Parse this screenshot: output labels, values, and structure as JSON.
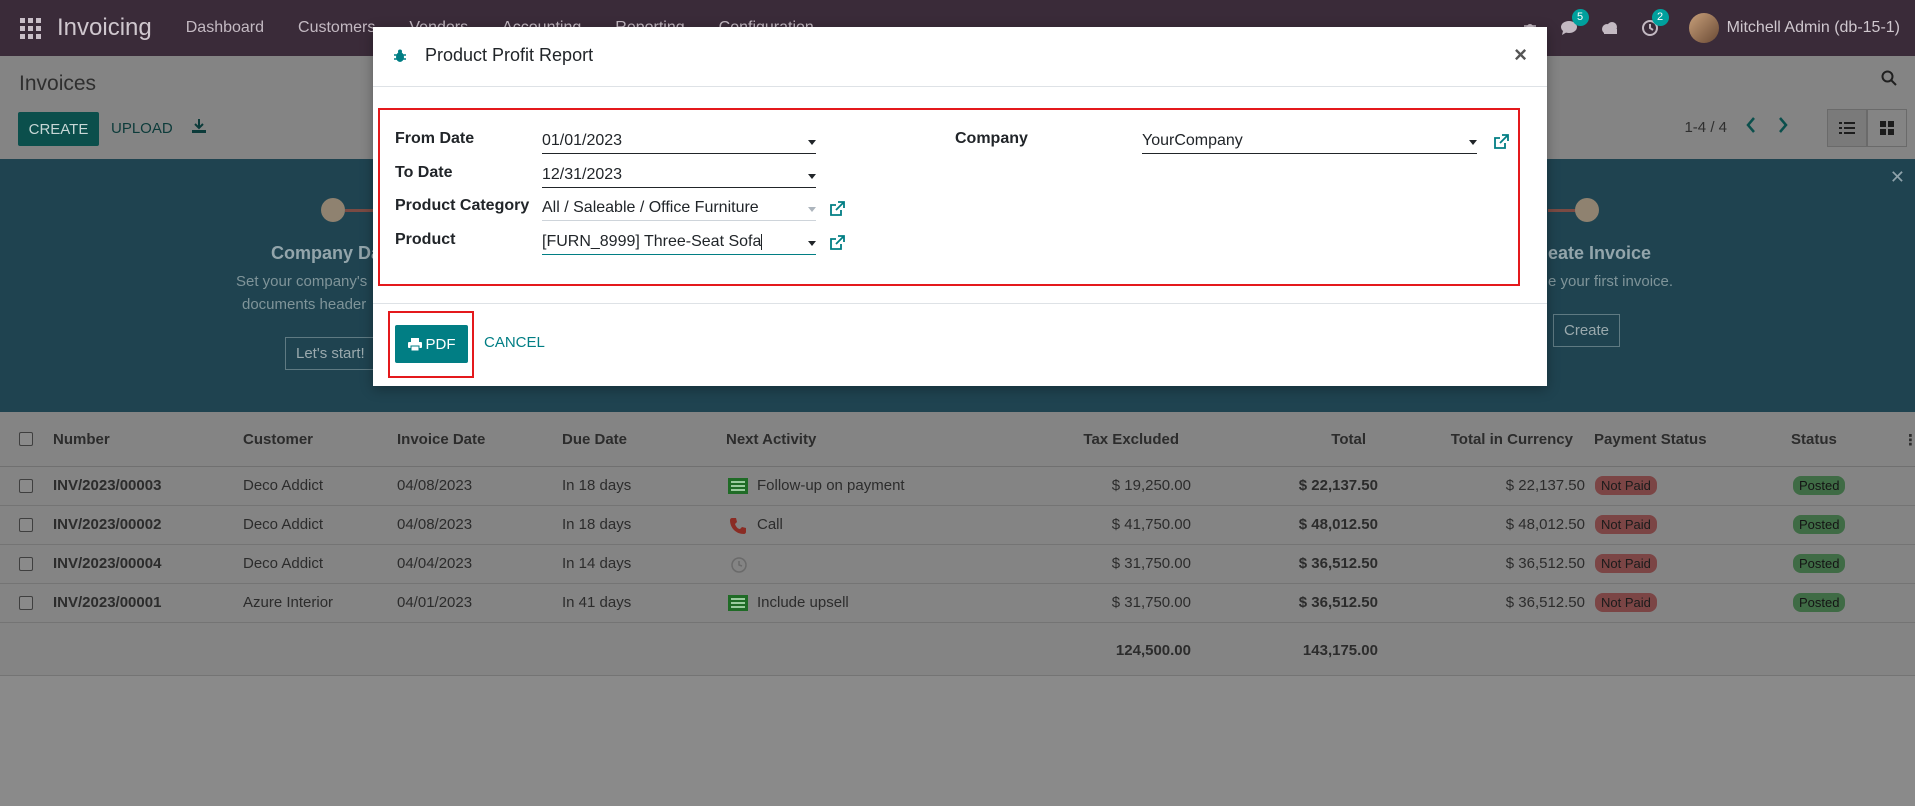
{
  "navbar": {
    "brand": "Invoicing",
    "menu": [
      "Dashboard",
      "Customers",
      "Vendors",
      "Accounting",
      "Reporting",
      "Configuration"
    ],
    "messages_badge": "5",
    "activities_badge": "2",
    "user": "Mitchell Admin (db-15-1)"
  },
  "control_panel": {
    "breadcrumb": "Invoices",
    "create_label": "CREATE",
    "upload_label": "UPLOAD",
    "pager": "1-4 / 4"
  },
  "banner": {
    "step1_title": "Company Da",
    "step1_line1": "Set your company's",
    "step1_line2": "documents header",
    "step1_button": "Let's start!",
    "step_last_title": "eate Invoice",
    "step_last_text": "e your first invoice.",
    "step_last_button": "Create"
  },
  "table": {
    "headers": [
      "Number",
      "Customer",
      "Invoice Date",
      "Due Date",
      "Next Activity",
      "Tax Excluded",
      "Total",
      "Total in Currency",
      "Payment Status",
      "Status"
    ],
    "rows": [
      {
        "number": "INV/2023/00003",
        "customer": "Deco Addict",
        "invoice_date": "04/08/2023",
        "due": "In 18 days",
        "activity": "Follow-up on payment",
        "activity_icon": "invoice-icon",
        "tax_excl": "$ 19,250.00",
        "total": "$ 22,137.50",
        "total_cur": "$ 22,137.50",
        "payment": "Not Paid",
        "status": "Posted"
      },
      {
        "number": "INV/2023/00002",
        "customer": "Deco Addict",
        "invoice_date": "04/08/2023",
        "due": "In 18 days",
        "activity": "Call",
        "activity_icon": "phone-icon",
        "tax_excl": "$ 41,750.00",
        "total": "$ 48,012.50",
        "total_cur": "$ 48,012.50",
        "payment": "Not Paid",
        "status": "Posted"
      },
      {
        "number": "INV/2023/00004",
        "customer": "Deco Addict",
        "invoice_date": "04/04/2023",
        "due": "In 14 days",
        "activity": "",
        "activity_icon": "clock-icon",
        "tax_excl": "$ 31,750.00",
        "total": "$ 36,512.50",
        "total_cur": "$ 36,512.50",
        "payment": "Not Paid",
        "status": "Posted"
      },
      {
        "number": "INV/2023/00001",
        "customer": "Azure Interior",
        "invoice_date": "04/01/2023",
        "due": "In 41 days",
        "activity": "Include upsell",
        "activity_icon": "invoice-icon",
        "tax_excl": "$ 31,750.00",
        "total": "$ 36,512.50",
        "total_cur": "$ 36,512.50",
        "payment": "Not Paid",
        "status": "Posted"
      }
    ],
    "total_tax_excl": "124,500.00",
    "total_total": "143,175.00"
  },
  "modal": {
    "title": "Product Profit Report",
    "fields": {
      "from_date_label": "From Date",
      "from_date_value": "01/01/2023",
      "to_date_label": "To Date",
      "to_date_value": "12/31/2023",
      "category_label": "Product Category",
      "category_value": "All / Saleable / Office Furniture",
      "product_label": "Product",
      "product_value": "[FURN_8999] Three-Seat Sofa",
      "company_label": "Company",
      "company_value": "YourCompany"
    },
    "pdf_label": "PDF",
    "cancel_label": "CANCEL"
  },
  "colors": {
    "primary": "#017e84",
    "highlight": "#e4191c",
    "navbar": "#3a2b39"
  }
}
